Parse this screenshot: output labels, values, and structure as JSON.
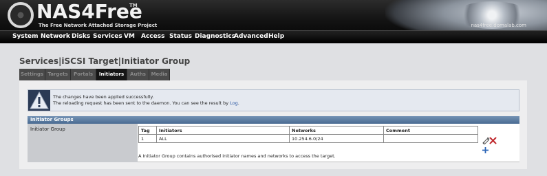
{
  "header": {
    "brand": "NAS4Free",
    "trademark": "TM",
    "tagline": "The Free Network Attached Storage Project",
    "hostname": "nas4free.domalab.com"
  },
  "nav": [
    "System",
    "Network",
    "Disks",
    "Services",
    "VM",
    "Access",
    "Status",
    "Diagnostics",
    "Advanced",
    "Help"
  ],
  "page_title": "Services|iSCSI Target|Initiator Group",
  "tabs": [
    {
      "label": "Settings",
      "active": false
    },
    {
      "label": "Targets",
      "active": false
    },
    {
      "label": "Portals",
      "active": false
    },
    {
      "label": "Initiators",
      "active": true
    },
    {
      "label": "Auths",
      "active": false
    },
    {
      "label": "Media",
      "active": false
    }
  ],
  "info": {
    "line1": "The changes have been applied successfully.",
    "line2_prefix": "The reloading request has been sent to the daemon. You can see the result by ",
    "line2_link": "Log",
    "line2_suffix": "."
  },
  "section": {
    "title": "Initiator Groups",
    "row_label": "Initiator Group",
    "columns": [
      "Tag",
      "Initiators",
      "Networks",
      "Comment"
    ],
    "rows": [
      {
        "tag": "1",
        "initiators": "ALL",
        "networks": "10.254.6.0/24",
        "comment": ""
      }
    ],
    "footnote": "A Initiator Group contains authorised initiator names and networks to access the target."
  },
  "icons": {
    "edit": "edit-icon",
    "delete": "delete-icon",
    "add": "add-icon"
  },
  "colors": {
    "section_bar": "#5a7aa2",
    "nav_bg": "#111111",
    "info_border": "#b7c0cf",
    "delete": "#c0282d",
    "add": "#2a64b6"
  }
}
